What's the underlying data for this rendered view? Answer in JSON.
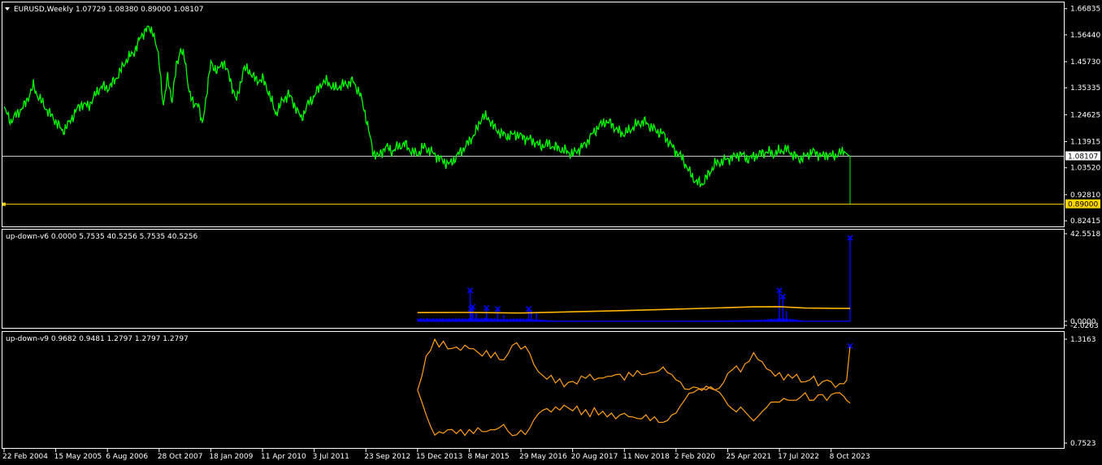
{
  "window": {
    "symbol_header": "EURUSD,Weekly  1.07729 1.08380 0.89000 1.08107"
  },
  "colors": {
    "background": "#000000",
    "frame": "#ffffff",
    "price_line": "#00ff00",
    "current_price_line": "#c8c8c8",
    "low_price_line": "#ffd700",
    "histogram": "#0000ff",
    "signal_line": "#ffb400",
    "v9_lines": "#ff9f1a",
    "marker": "#0000ff",
    "text": "#ffffff"
  },
  "chart_data": [
    {
      "panel": "main",
      "type": "line",
      "title": "EURUSD,Weekly  1.07729 1.08380 0.89000 1.08107",
      "y_ticks": [
        "1.66835",
        "1.56440",
        "1.45730",
        "1.35335",
        "1.24625",
        "1.13915",
        "1.03520",
        "0.92810",
        "0.82415"
      ],
      "ylim": [
        0.805,
        1.69
      ],
      "x_labels": [
        "22 Feb 2004",
        "15 May 2005",
        "6 Aug 2006",
        "28 Oct 2007",
        "18 Jan 2009",
        "11 Apr 2010",
        "3 Jul 2011",
        "23 Sep 2012",
        "15 Dec 2013",
        "8 Mar 2015",
        "29 May 2016",
        "20 Aug 2017",
        "11 Nov 2018",
        "2 Feb 2020",
        "25 Apr 2021",
        "17 Jul 2022",
        "8 Oct 2023"
      ],
      "x_index": [
        0,
        60,
        120,
        180,
        240,
        300,
        360,
        420,
        480,
        540,
        600,
        660,
        720,
        780,
        840,
        900,
        960
      ],
      "series": [
        {
          "x": [
            0,
            8,
            15,
            23,
            30,
            34,
            38,
            45,
            53,
            60,
            68,
            75,
            83,
            90,
            98,
            105,
            113,
            120,
            128,
            135,
            143,
            150,
            158,
            165,
            173,
            180,
            185,
            190,
            195,
            200,
            205,
            210,
            215,
            220,
            225,
            230,
            235,
            240,
            248,
            255,
            263,
            270,
            278,
            285,
            293,
            300,
            308,
            315,
            323,
            330,
            338,
            345,
            353,
            360,
            368,
            375,
            383,
            390,
            398,
            405,
            413,
            420,
            428,
            435,
            443,
            450,
            458,
            465,
            473,
            480,
            488,
            495,
            503,
            510,
            518,
            525,
            533,
            540,
            548,
            555,
            563,
            570,
            578,
            585,
            593,
            600,
            608,
            615,
            623,
            630,
            638,
            645,
            653,
            660,
            668,
            675,
            683,
            690,
            698,
            705,
            713,
            720,
            728,
            735,
            743,
            750,
            758,
            765,
            773,
            780,
            788,
            795,
            803,
            810,
            818,
            825,
            833,
            840,
            848,
            855,
            863,
            870,
            878,
            885,
            893,
            900,
            908,
            915,
            923,
            930,
            938,
            945,
            950,
            955,
            962,
            968,
            975,
            982
          ],
          "values": [
            1.27,
            1.22,
            1.25,
            1.28,
            1.33,
            1.36,
            1.33,
            1.29,
            1.25,
            1.22,
            1.18,
            1.21,
            1.26,
            1.29,
            1.28,
            1.32,
            1.36,
            1.35,
            1.38,
            1.42,
            1.47,
            1.49,
            1.55,
            1.59,
            1.58,
            1.46,
            1.28,
            1.4,
            1.3,
            1.44,
            1.51,
            1.46,
            1.34,
            1.28,
            1.3,
            1.2,
            1.33,
            1.45,
            1.42,
            1.46,
            1.38,
            1.3,
            1.43,
            1.42,
            1.38,
            1.39,
            1.33,
            1.25,
            1.3,
            1.33,
            1.28,
            1.23,
            1.29,
            1.32,
            1.37,
            1.38,
            1.35,
            1.36,
            1.37,
            1.38,
            1.33,
            1.24,
            1.1,
            1.08,
            1.12,
            1.1,
            1.12,
            1.13,
            1.1,
            1.09,
            1.12,
            1.1,
            1.08,
            1.06,
            1.05,
            1.08,
            1.11,
            1.14,
            1.18,
            1.24,
            1.23,
            1.19,
            1.17,
            1.16,
            1.17,
            1.16,
            1.15,
            1.14,
            1.12,
            1.13,
            1.12,
            1.11,
            1.1,
            1.09,
            1.11,
            1.13,
            1.17,
            1.2,
            1.22,
            1.21,
            1.18,
            1.17,
            1.19,
            1.21,
            1.22,
            1.2,
            1.18,
            1.17,
            1.13,
            1.1,
            1.07,
            1.02,
            0.98,
            0.97,
            1.01,
            1.05,
            1.06,
            1.07,
            1.08,
            1.09,
            1.07,
            1.08,
            1.09,
            1.1,
            1.09,
            1.1,
            1.11,
            1.09,
            1.07,
            1.08,
            1.1,
            1.09,
            1.08,
            1.09,
            1.08,
            1.09,
            1.1,
            1.08
          ],
          "close": 1.08107,
          "low": 0.89
        }
      ],
      "price_labels": {
        "current": "1.08107",
        "low": "0.89000"
      },
      "current_price": 1.08107,
      "low_price": 0.89,
      "grid": false
    },
    {
      "panel": "indicator-1",
      "type": "bar",
      "title": "up-down-v6 0.0000 5.7535 40.5256 5.7535 40.5256",
      "y_ticks": [
        "42.5518",
        "0.0000",
        "-2.0263"
      ],
      "ylim": [
        -2.0263,
        42.5518
      ],
      "peaks": [
        {
          "x": 541,
          "value": 15.0
        },
        {
          "x": 542,
          "value": 6.0
        },
        {
          "x": 544,
          "value": 7.0
        },
        {
          "x": 548,
          "value": 4.5
        },
        {
          "x": 560,
          "value": 6.5
        },
        {
          "x": 573,
          "value": 6.0
        },
        {
          "x": 580,
          "value": 3.0
        },
        {
          "x": 609,
          "value": 6.0
        },
        {
          "x": 612,
          "value": 5.5
        },
        {
          "x": 618,
          "value": 4.0
        },
        {
          "x": 900,
          "value": 15.0
        },
        {
          "x": 904,
          "value": 12.0
        },
        {
          "x": 908,
          "value": 5.0
        },
        {
          "x": 982,
          "value": 40.5256
        }
      ],
      "baseline_levels": [
        {
          "x": 540,
          "value": 1.5
        },
        {
          "x": 560,
          "value": 1.8
        },
        {
          "x": 580,
          "value": 1.2
        },
        {
          "x": 600,
          "value": 1.5
        },
        {
          "x": 620,
          "value": 1.0
        },
        {
          "x": 640,
          "value": 0.3
        },
        {
          "x": 700,
          "value": 0.2
        },
        {
          "x": 760,
          "value": 0.2
        },
        {
          "x": 820,
          "value": 0.3
        },
        {
          "x": 880,
          "value": 0.8
        },
        {
          "x": 900,
          "value": 1.6
        },
        {
          "x": 915,
          "value": 1.2
        },
        {
          "x": 930,
          "value": 0.2
        },
        {
          "x": 982,
          "value": 0.2
        }
      ],
      "signal_line": {
        "x": [
          480,
          540,
          600,
          660,
          720,
          780,
          840,
          870,
          900,
          930,
          960,
          982
        ],
        "values": [
          4.2,
          4.3,
          4.0,
          4.6,
          5.2,
          5.9,
          6.6,
          7.0,
          7.1,
          6.4,
          6.3,
          6.2
        ]
      },
      "marker_x": [
        511,
        544,
        608,
        904,
        981
      ]
    },
    {
      "panel": "indicator-2",
      "type": "line",
      "title": "up-down-v9 0.9682 0.9481 1.2797 1.2797 1.2797",
      "y_ticks": [
        "1.3163",
        "0.7523"
      ],
      "ylim": [
        0.7523,
        1.3163
      ],
      "series": [
        {
          "x": [
            480,
            485,
            490,
            495,
            500,
            505,
            510,
            515,
            520,
            525,
            530,
            535,
            540,
            545,
            550,
            555,
            560,
            565,
            570,
            575,
            580,
            585,
            590,
            595,
            600,
            605,
            610,
            615,
            620,
            625,
            630,
            635,
            640,
            645,
            650,
            655,
            660,
            665,
            670,
            675,
            680,
            685,
            690,
            695,
            700,
            705,
            710,
            715,
            720,
            725,
            730,
            735,
            740,
            745,
            750,
            755,
            760,
            765,
            770,
            775,
            780,
            785,
            790,
            795,
            800,
            805,
            810,
            815,
            820,
            825,
            830,
            835,
            840,
            845,
            850,
            855,
            860,
            865,
            870,
            875,
            880,
            885,
            890,
            895,
            900,
            905,
            910,
            915,
            920,
            925,
            930,
            935,
            940,
            945,
            950,
            955,
            960,
            965,
            970,
            975,
            978,
            982
          ],
          "values": [
            1.04,
            1.12,
            1.22,
            1.26,
            1.31,
            1.28,
            1.3,
            1.27,
            1.26,
            1.28,
            1.25,
            1.29,
            1.26,
            1.27,
            1.24,
            1.23,
            1.25,
            1.22,
            1.24,
            1.21,
            1.2,
            1.24,
            1.28,
            1.3,
            1.26,
            1.28,
            1.24,
            1.18,
            1.14,
            1.12,
            1.1,
            1.12,
            1.08,
            1.1,
            1.06,
            1.08,
            1.09,
            1.07,
            1.12,
            1.1,
            1.13,
            1.09,
            1.11,
            1.1,
            1.12,
            1.11,
            1.13,
            1.12,
            1.1,
            1.13,
            1.12,
            1.14,
            1.13,
            1.12,
            1.14,
            1.13,
            1.15,
            1.16,
            1.14,
            1.12,
            1.1,
            1.08,
            1.05,
            1.04,
            1.06,
            1.05,
            1.04,
            1.06,
            1.05,
            1.04,
            1.05,
            1.08,
            1.13,
            1.15,
            1.17,
            1.14,
            1.18,
            1.2,
            1.24,
            1.21,
            1.19,
            1.16,
            1.14,
            1.12,
            1.13,
            1.1,
            1.12,
            1.11,
            1.12,
            1.09,
            1.08,
            1.1,
            1.11,
            1.07,
            1.08,
            1.1,
            1.08,
            1.06,
            1.07,
            1.08,
            1.1,
            1.28
          ]
        },
        {
          "x": [
            480,
            485,
            490,
            495,
            500,
            505,
            510,
            515,
            520,
            525,
            530,
            535,
            540,
            545,
            550,
            555,
            560,
            565,
            570,
            575,
            580,
            585,
            590,
            595,
            600,
            605,
            610,
            615,
            620,
            625,
            630,
            635,
            640,
            645,
            650,
            655,
            660,
            665,
            670,
            675,
            680,
            685,
            690,
            695,
            700,
            705,
            710,
            715,
            720,
            725,
            730,
            735,
            740,
            745,
            750,
            755,
            760,
            765,
            770,
            775,
            780,
            785,
            790,
            795,
            800,
            805,
            810,
            815,
            820,
            825,
            830,
            835,
            840,
            845,
            850,
            855,
            860,
            865,
            870,
            875,
            880,
            885,
            890,
            895,
            900,
            905,
            910,
            915,
            920,
            925,
            930,
            935,
            940,
            945,
            950,
            955,
            960,
            965,
            970,
            975,
            978,
            982
          ],
          "values": [
            1.04,
            0.98,
            0.9,
            0.85,
            0.79,
            0.82,
            0.8,
            0.83,
            0.82,
            0.81,
            0.82,
            0.8,
            0.82,
            0.81,
            0.83,
            0.82,
            0.81,
            0.83,
            0.82,
            0.84,
            0.85,
            0.82,
            0.79,
            0.8,
            0.82,
            0.8,
            0.83,
            0.88,
            0.91,
            0.93,
            0.94,
            0.92,
            0.95,
            0.93,
            0.96,
            0.94,
            0.93,
            0.95,
            0.91,
            0.93,
            0.9,
            0.94,
            0.91,
            0.92,
            0.9,
            0.91,
            0.89,
            0.9,
            0.92,
            0.89,
            0.9,
            0.88,
            0.89,
            0.9,
            0.88,
            0.89,
            0.87,
            0.86,
            0.88,
            0.9,
            0.92,
            0.95,
            0.99,
            1.02,
            1.03,
            1.04,
            1.05,
            1.04,
            1.06,
            1.04,
            1.03,
            1.0,
            0.96,
            0.94,
            0.92,
            0.95,
            0.92,
            0.9,
            0.87,
            0.9,
            0.92,
            0.95,
            0.97,
            0.98,
            0.97,
            1.0,
            0.98,
            0.99,
            0.98,
            1.01,
            1.02,
            0.99,
            0.98,
            1.02,
            1.01,
            0.99,
            1.01,
            1.03,
            1.02,
            1.01,
            0.99,
            0.97
          ]
        }
      ],
      "end_marker": {
        "x": 982,
        "value": 1.2797
      }
    }
  ]
}
